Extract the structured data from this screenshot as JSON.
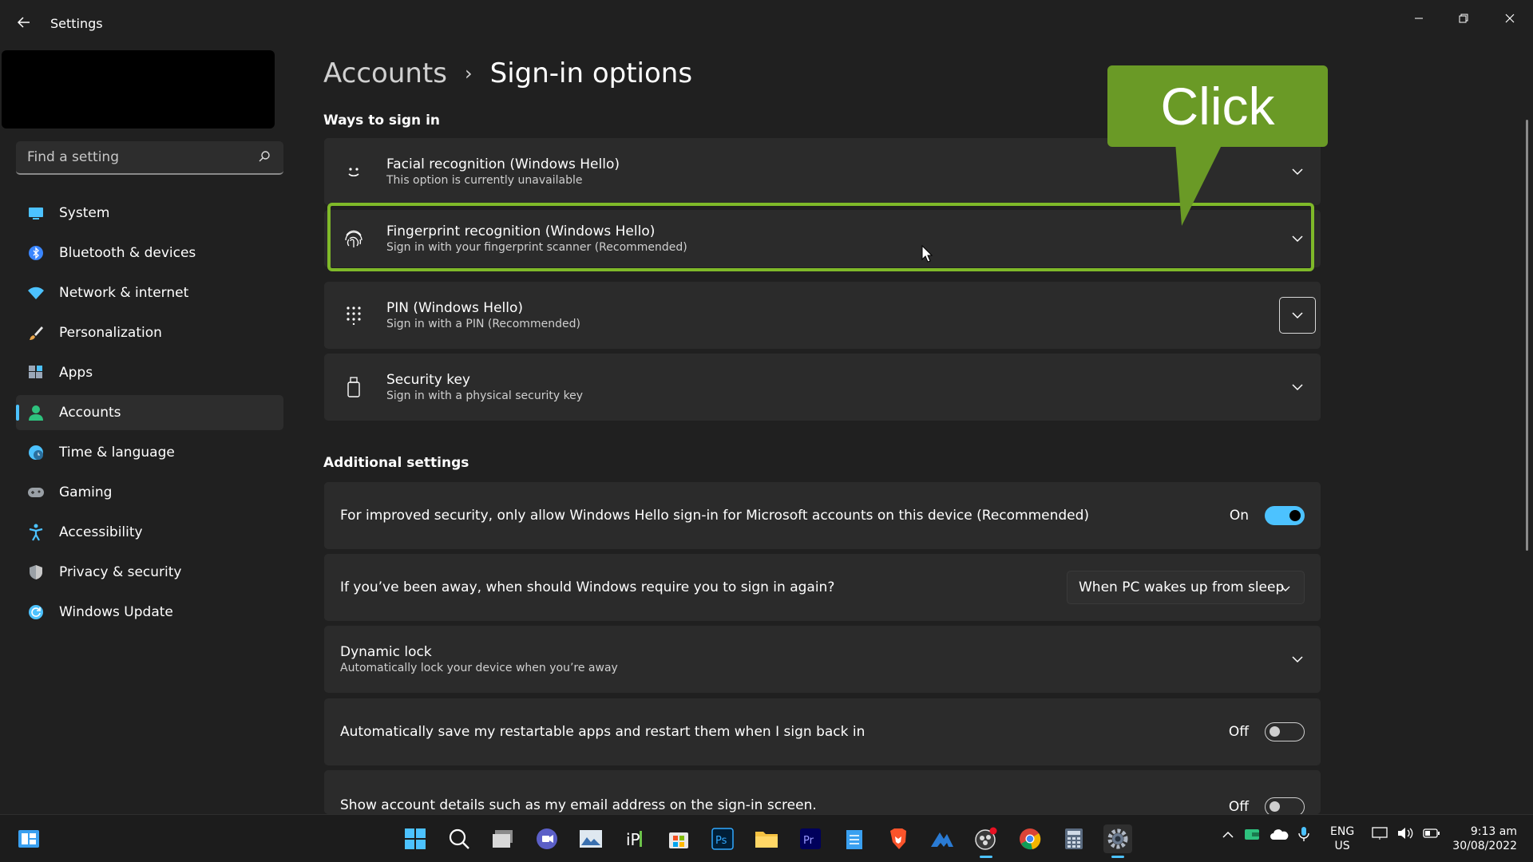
{
  "window": {
    "title": "Settings"
  },
  "sidebar": {
    "search_placeholder": "Find a setting",
    "items": [
      {
        "label": "System",
        "icon": "monitor-icon",
        "color": "#4cc2ff"
      },
      {
        "label": "Bluetooth & devices",
        "icon": "bluetooth-icon",
        "color": "#3a86ff"
      },
      {
        "label": "Network & internet",
        "icon": "wifi-icon",
        "color": "#4cc2ff"
      },
      {
        "label": "Personalization",
        "icon": "brush-icon",
        "color": "#e8a54b"
      },
      {
        "label": "Apps",
        "icon": "apps-icon",
        "color": "#9aa7b8"
      },
      {
        "label": "Accounts",
        "icon": "person-icon",
        "color": "#2ec27e",
        "active": true
      },
      {
        "label": "Time & language",
        "icon": "globe-clock-icon",
        "color": "#4cc2ff"
      },
      {
        "label": "Gaming",
        "icon": "gamepad-icon",
        "color": "#9aa0a6"
      },
      {
        "label": "Accessibility",
        "icon": "accessibility-icon",
        "color": "#4cc2ff"
      },
      {
        "label": "Privacy & security",
        "icon": "shield-icon",
        "color": "#9aa0a6"
      },
      {
        "label": "Windows Update",
        "icon": "refresh-icon",
        "color": "#4cc2ff"
      }
    ]
  },
  "breadcrumb": {
    "parent": "Accounts",
    "separator": "›",
    "current": "Sign-in options"
  },
  "ways_to_sign_in": {
    "title": "Ways to sign in",
    "options": [
      {
        "title": "Facial recognition (Windows Hello)",
        "subtitle": "This option is currently unavailable",
        "icon": "smile-face-icon"
      },
      {
        "title": "Fingerprint recognition (Windows Hello)",
        "subtitle": "Sign in with your fingerprint scanner (Recommended)",
        "icon": "fingerprint-icon"
      },
      {
        "title": "PIN (Windows Hello)",
        "subtitle": "Sign in with a PIN (Recommended)",
        "icon": "keypad-icon"
      },
      {
        "title": "Security key",
        "subtitle": "Sign in with a physical security key",
        "icon": "usb-key-icon"
      }
    ]
  },
  "additional_settings": {
    "title": "Additional settings",
    "hello_only": {
      "label": "For improved security, only allow Windows Hello sign-in for Microsoft accounts on this device (Recommended)",
      "state": "On"
    },
    "require_signin": {
      "label": "If you’ve been away, when should Windows require you to sign in again?",
      "value": "When PC wakes up from sleep"
    },
    "dynamic_lock": {
      "title": "Dynamic lock",
      "subtitle": "Automatically lock your device when you’re away"
    },
    "restart_apps": {
      "label": "Automatically save my restartable apps and restart them when I sign back in",
      "state": "Off"
    },
    "account_details": {
      "label": "Show account details such as my email address on the sign-in screen.",
      "state": "Off"
    }
  },
  "callout": {
    "text": "Click",
    "color": "#6a9a26",
    "border": "#7fb929"
  },
  "taskbar": {
    "lang_top": "ENG",
    "lang_bottom": "US",
    "time": "9:13 am",
    "date": "30/08/2022",
    "apps": [
      "widgets-icon",
      "start-icon",
      "search-icon",
      "task-view-icon",
      "teams-icon",
      "photos-icon",
      "ipvanish-icon",
      "store-icon",
      "photoshop-icon",
      "explorer-icon",
      "premiere-icon",
      "notepad-icon",
      "brave-icon",
      "malwarebytes-icon",
      "obs-icon",
      "chrome-icon",
      "calculator-icon",
      "settings-icon"
    ]
  },
  "accent": "#4cc2ff"
}
